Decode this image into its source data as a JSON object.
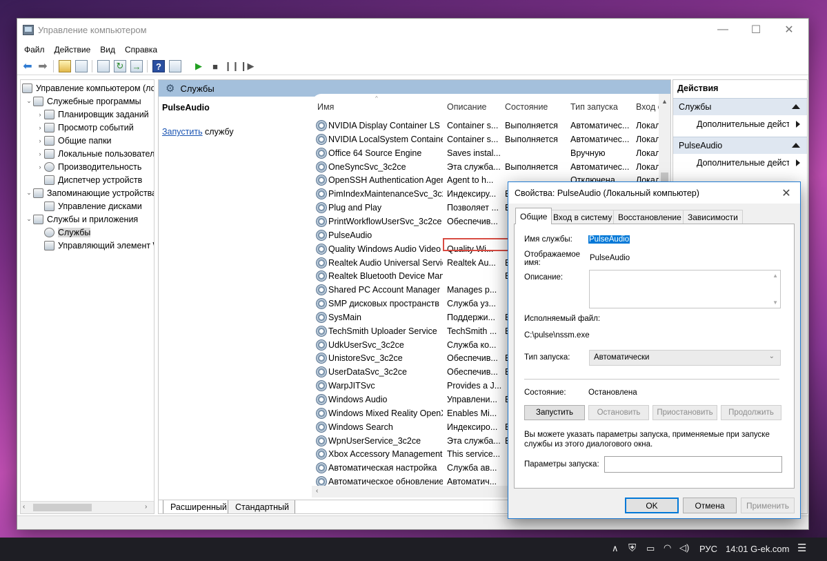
{
  "window": {
    "title": "Управление компьютером"
  },
  "menu": [
    "Файл",
    "Действие",
    "Вид",
    "Справка"
  ],
  "tree": [
    {
      "label": "Управление компьютером (локальным)",
      "depth": 0,
      "arrow": ""
    },
    {
      "label": "Служебные программы",
      "depth": 1,
      "arrow": "⌄"
    },
    {
      "label": "Планировщик заданий",
      "depth": 2,
      "arrow": "›"
    },
    {
      "label": "Просмотр событий",
      "depth": 2,
      "arrow": "›"
    },
    {
      "label": "Общие папки",
      "depth": 2,
      "arrow": "›"
    },
    {
      "label": "Локальные пользователи и группы",
      "depth": 2,
      "arrow": "›"
    },
    {
      "label": "Производительность",
      "depth": 2,
      "arrow": "›"
    },
    {
      "label": "Диспетчер устройств",
      "depth": 2,
      "arrow": ""
    },
    {
      "label": "Запоминающие устройства",
      "depth": 1,
      "arrow": "⌄"
    },
    {
      "label": "Управление дисками",
      "depth": 2,
      "arrow": ""
    },
    {
      "label": "Службы и приложения",
      "depth": 1,
      "arrow": "⌄"
    },
    {
      "label": "Службы",
      "depth": 2,
      "arrow": "",
      "selected": true
    },
    {
      "label": "Управляющий элемент WMI",
      "depth": 2,
      "arrow": ""
    }
  ],
  "center": {
    "header": "Службы",
    "selected_name": "PulseAudio",
    "start_link": "Запустить",
    "start_link_rest": " службу",
    "columns": [
      "Имя",
      "Описание",
      "Состояние",
      "Тип запуска",
      "Вход от имени"
    ],
    "services": [
      [
        "NVIDIA Display Container LS",
        "Container s...",
        "Выполняется",
        "Автоматичес...",
        "Локальная"
      ],
      [
        "NVIDIA LocalSystem Container",
        "Container s...",
        "Выполняется",
        "Автоматичес...",
        "Локальная"
      ],
      [
        "Office 64 Source Engine",
        "Saves instal...",
        "",
        "Вручную",
        "Локальная"
      ],
      [
        "OneSyncSvc_3c2ce",
        "Эта служба...",
        "Выполняется",
        "Автоматичес...",
        "Локальная"
      ],
      [
        "OpenSSH Authentication Agent",
        "Agent to h...",
        "",
        "Отключена",
        "Локальная"
      ],
      [
        "PimIndexMaintenanceSvc_3c2ce",
        "Индексиру...",
        "В",
        "",
        ""
      ],
      [
        "Plug and Play",
        "Позволяет ...",
        "В",
        "",
        ""
      ],
      [
        "PrintWorkflowUserSvc_3c2ce",
        "Обеспечив...",
        "",
        "",
        ""
      ],
      [
        "PulseAudio",
        "",
        "",
        "",
        ""
      ],
      [
        "Quality Windows Audio Video",
        "Quality Wi...",
        "",
        "",
        ""
      ],
      [
        "Realtek Audio Universal Service",
        "Realtek Au...",
        "В",
        "",
        ""
      ],
      [
        "Realtek Bluetooth Device Manager",
        "",
        "В",
        "",
        ""
      ],
      [
        "Shared PC Account Manager",
        "Manages p...",
        "",
        "",
        ""
      ],
      [
        "SMP дисковых пространств",
        "Служба уз...",
        "",
        "",
        ""
      ],
      [
        "SysMain",
        "Поддержи...",
        "В",
        "",
        ""
      ],
      [
        "TechSmith Uploader Service",
        "TechSmith ...",
        "В",
        "",
        ""
      ],
      [
        "UdkUserSvc_3c2ce",
        "Служба ко...",
        "",
        "",
        ""
      ],
      [
        "UnistoreSvc_3c2ce",
        "Обеспечив...",
        "В",
        "",
        ""
      ],
      [
        "UserDataSvc_3c2ce",
        "Обеспечив...",
        "В",
        "",
        ""
      ],
      [
        "WarpJITSvc",
        "Provides a J...",
        "",
        "",
        ""
      ],
      [
        "Windows Audio",
        "Управлени...",
        "В",
        "",
        ""
      ],
      [
        "Windows Mixed Reality OpenXR",
        "Enables Mi...",
        "",
        "",
        ""
      ],
      [
        "Windows Search",
        "Индексиро...",
        "В",
        "",
        ""
      ],
      [
        "WpnUserService_3c2ce",
        "Эта служба...",
        "В",
        "",
        ""
      ],
      [
        "Xbox Accessory Management",
        "This service...",
        "",
        "",
        ""
      ],
      [
        "Автоматическая настройка",
        "Служба ав...",
        "",
        "",
        ""
      ],
      [
        "Автоматическое обновление",
        "Автоматич...",
        "",
        "",
        ""
      ]
    ],
    "tabs": [
      "Расширенный",
      "Стандартный"
    ]
  },
  "actions": {
    "header": "Действия",
    "sections": [
      {
        "title": "Службы",
        "item": "Дополнительные действия"
      },
      {
        "title": "PulseAudio",
        "item": "Дополнительные действия"
      }
    ]
  },
  "dialog": {
    "title": "Свойства: PulseAudio (Локальный компьютер)",
    "tabs": [
      "Общие",
      "Вход в систему",
      "Восстановление",
      "Зависимости"
    ],
    "service_name_label": "Имя службы:",
    "service_name": "PulseAudio",
    "display_name_label_1": "Отображаемое",
    "display_name_label_2": "имя:",
    "display_name": "PulseAudio",
    "description_label": "Описание:",
    "exe_label": "Исполняемый файл:",
    "exe_path": "C:\\pulse\\nssm.exe",
    "startup_type_label": "Тип запуска:",
    "startup_type": "Автоматически",
    "status_label": "Состояние:",
    "status": "Остановлена",
    "buttons": {
      "start": "Запустить",
      "stop": "Остановить",
      "pause": "Приостановить",
      "resume": "Продолжить"
    },
    "info_text": "Вы можете указать параметры запуска, применяемые при запуске службы из этого диалогового окна.",
    "params_label": "Параметры запуска:",
    "ok": "OK",
    "cancel": "Отмена",
    "apply": "Применить"
  },
  "taskbar": {
    "language": "РУС",
    "clock": "14:01 G-ek.com"
  }
}
